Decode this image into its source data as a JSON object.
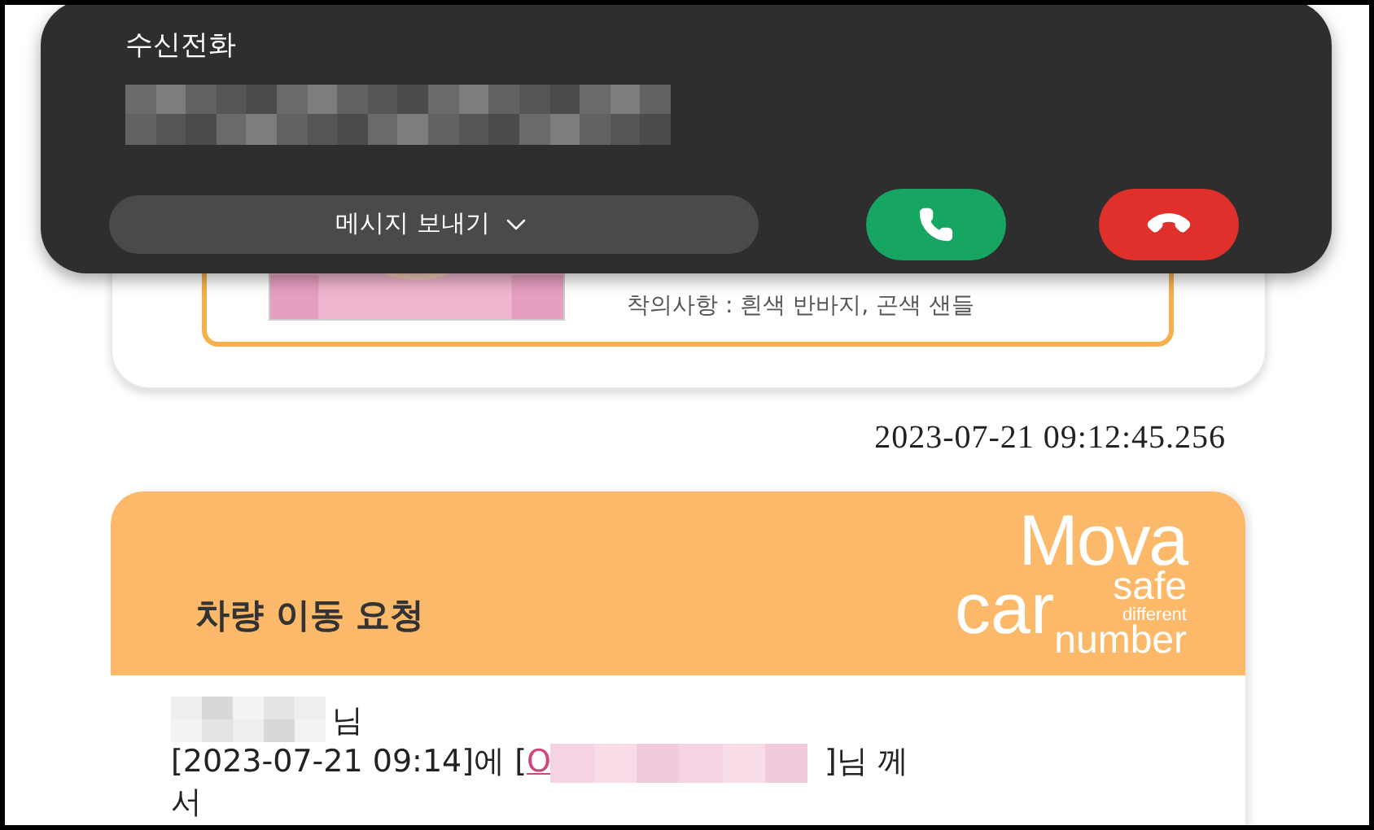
{
  "call": {
    "title": "수신전화",
    "message_button": {
      "label": "메시지 보내기"
    }
  },
  "profile_card": {
    "detail": "착의사항 : 흰색 반바지, 곤색 샌들"
  },
  "timestamp": "2023-07-21 09:12:45.256",
  "request_card": {
    "title": "차량 이동 요청",
    "logo": {
      "line1": "Mova",
      "line2a": "car",
      "line2b": "safe",
      "line3": "different",
      "line4": "number"
    },
    "suffix1": "님",
    "line_prefix": "[2023-07-21 09:14]에 [",
    "link": "O",
    "line_suffix": "]님 께",
    "line2": "서"
  }
}
